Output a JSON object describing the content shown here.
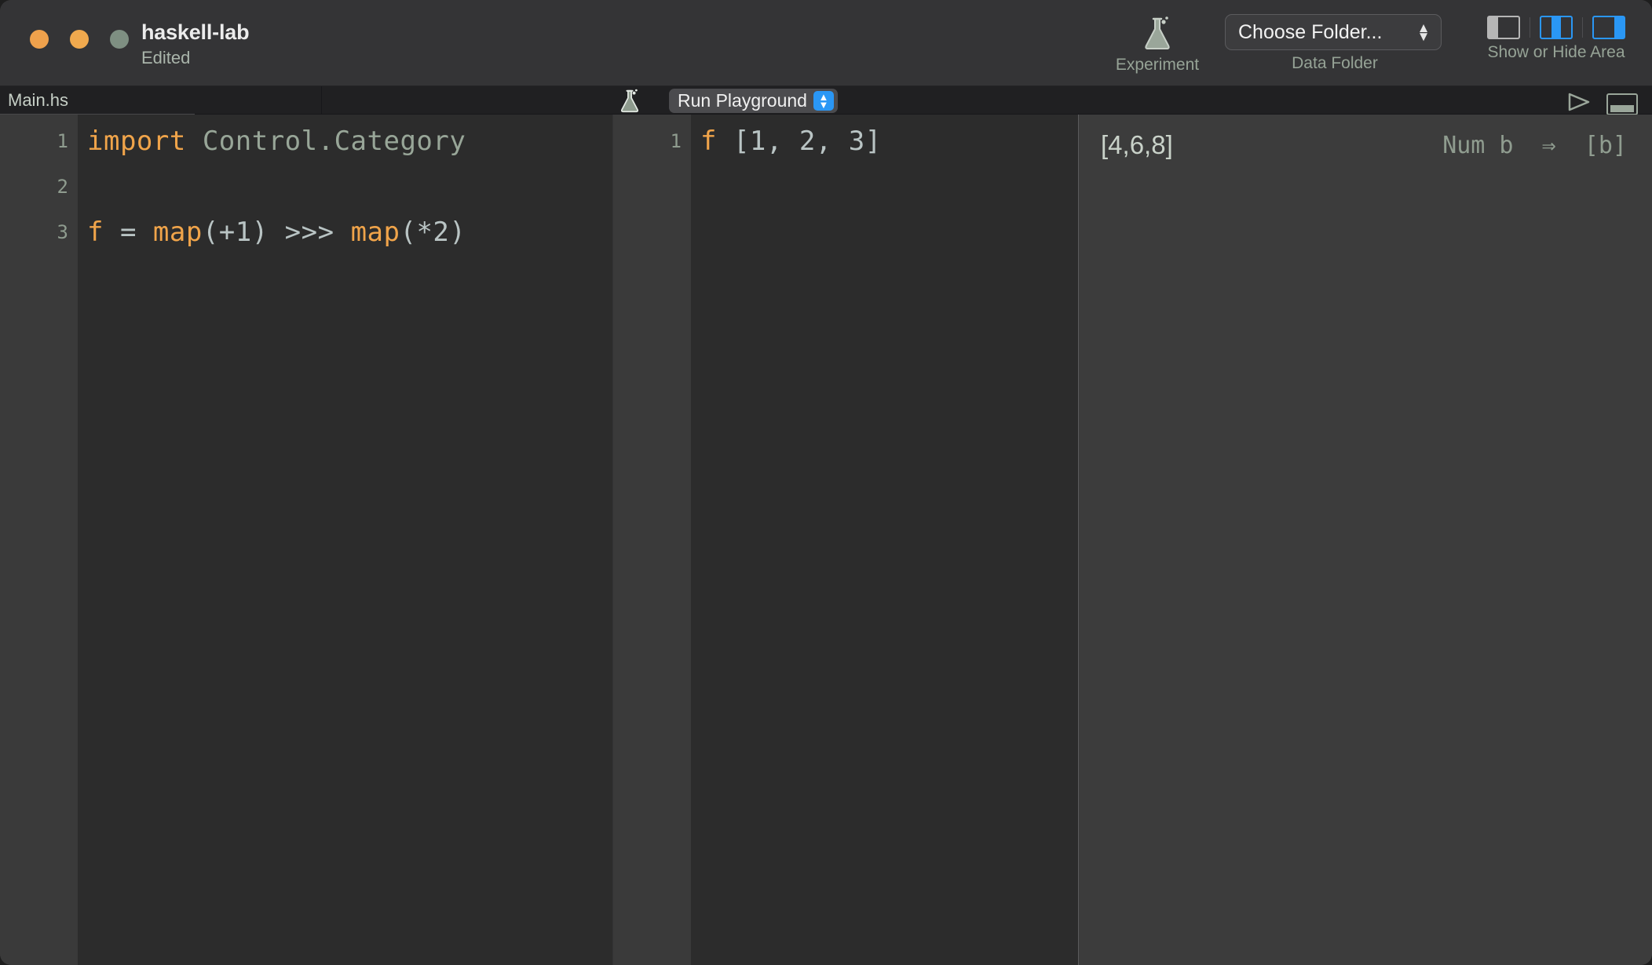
{
  "window": {
    "title": "haskell-lab",
    "subtitle": "Edited",
    "traffic_lights": [
      "close-button",
      "minimize-button",
      "zoom-button"
    ]
  },
  "toolbar": {
    "experiment": {
      "icon": "flask-icon",
      "label": "Experiment"
    },
    "data_folder": {
      "value": "Choose Folder...",
      "label": "Data Folder",
      "icon": "stepper-chevron-icon"
    },
    "show_hide_area": {
      "label": "Show or Hide Area",
      "toggles": [
        {
          "name": "left-panel-toggle",
          "active": false
        },
        {
          "name": "center-panel-toggle",
          "active": true
        },
        {
          "name": "right-panel-toggle",
          "active": true
        }
      ],
      "active_color": "#2a97f5",
      "inactive_color": "#b6b6b6"
    }
  },
  "tabbar": {
    "tab_label": "Main.hs",
    "flask_icon": "flask-icon",
    "run_button_label": "Run Playground",
    "run_button_accent": "#2a97f5",
    "play_icon": "play-triangle-icon",
    "bottom_panel_icon": "bottom-panel-toggle-icon"
  },
  "editor": {
    "gutter": [
      "1",
      "2",
      "3"
    ],
    "lines": [
      {
        "tokens": [
          {
            "text": "import",
            "cls": "kw"
          },
          {
            "text": " ",
            "cls": "op"
          },
          {
            "text": "Control.Category",
            "cls": "id"
          }
        ]
      },
      {
        "tokens": []
      },
      {
        "tokens": [
          {
            "text": "f",
            "cls": "fn"
          },
          {
            "text": " = ",
            "cls": "op"
          },
          {
            "text": "map",
            "cls": "fn"
          },
          {
            "text": "(+1) >>> ",
            "cls": "op"
          },
          {
            "text": "map",
            "cls": "fn"
          },
          {
            "text": "(*2)",
            "cls": "op"
          }
        ]
      }
    ]
  },
  "playground_input": {
    "gutter": [
      "1"
    ],
    "lines": [
      {
        "tokens": [
          {
            "text": "f",
            "cls": "fn"
          },
          {
            "text": " [1, 2, 3]",
            "cls": "op"
          }
        ]
      }
    ]
  },
  "results": {
    "value": "[4,6,8]",
    "type_signature": "Num b  ⇒  [b]"
  },
  "colors": {
    "titlebar_bg": "#343436",
    "tabbar_bg": "#202022",
    "editor_bg": "#2c2c2c",
    "gutter_bg": "#3a3a3a",
    "results_bg": "#3c3c3c",
    "keyword": "#f0a44a",
    "identifier": "#98a698",
    "operator": "#b9c4c4"
  }
}
